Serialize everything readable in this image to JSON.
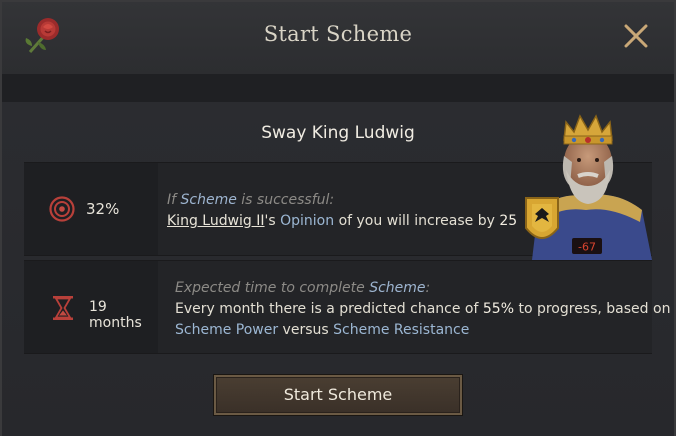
{
  "window": {
    "title": "Start Scheme"
  },
  "scheme": {
    "name": "Sway King Ludwig"
  },
  "success": {
    "chance": "32%",
    "if_prefix": "If ",
    "if_keyword": "Scheme",
    "if_suffix": " is successful:",
    "target_name": "King Ludwig II",
    "possessive": "'s ",
    "opinion_keyword": "Opinion",
    "effect_text": " of you will increase by ",
    "amount": "25"
  },
  "time": {
    "duration": "19 months",
    "expected_prefix": "Expected time to complete ",
    "expected_keyword": "Scheme",
    "expected_suffix": ":",
    "line1_prefix": "Every month there is a predicted chance of ",
    "line1_percent": "55%",
    "line1_suffix": " to progress, based on",
    "power_keyword": "Scheme Power",
    "versus": " versus ",
    "resistance_keyword": "Scheme Resistance"
  },
  "portrait": {
    "opinion_badge": "-67"
  },
  "button": {
    "label": "Start Scheme"
  },
  "colors": {
    "keyword": "#9cb7d3",
    "badge": "#d9442f",
    "button_border": "#6b5a44"
  },
  "icons": [
    "rose-icon",
    "close-icon",
    "target-icon",
    "hourglass-icon",
    "coat-of-arms-icon"
  ]
}
